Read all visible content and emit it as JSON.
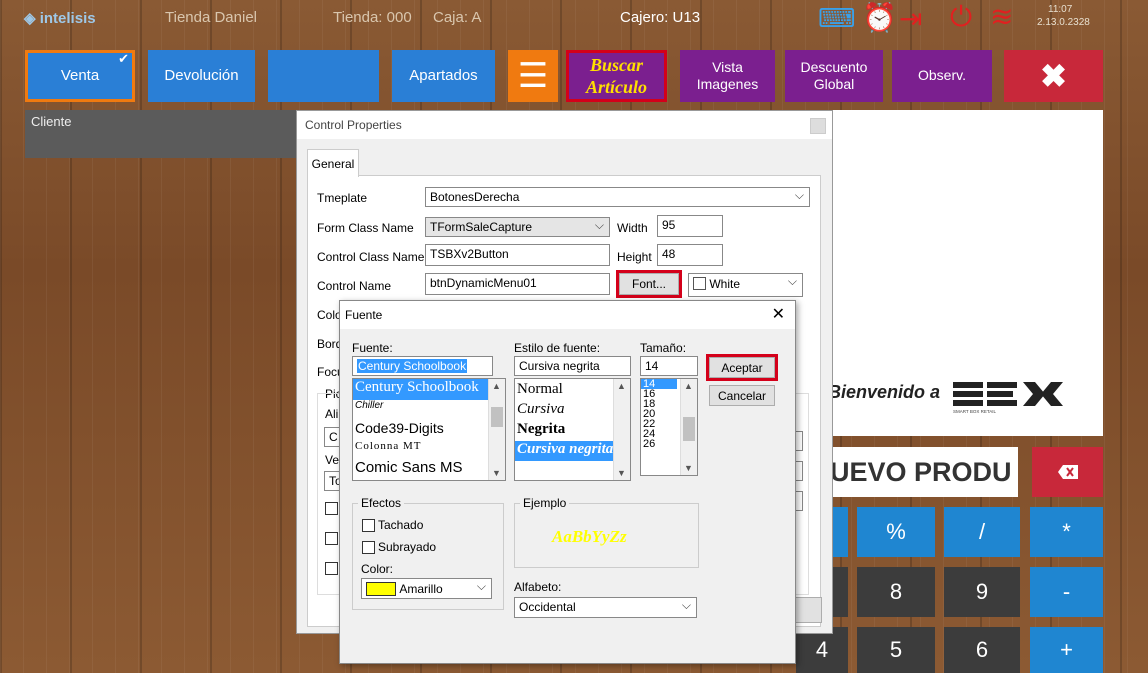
{
  "topbar": {
    "logo": "intelisis",
    "store_user": "Tienda Daniel",
    "store_id": "Tienda: 000",
    "register": "Caja: A",
    "cashier": "Cajero: U13",
    "time": "11:07",
    "version": "2.13.0.2328"
  },
  "actions": {
    "venta": "Venta",
    "devolucion": "Devolución",
    "blank": "",
    "apartados": "Apartados",
    "buscar_line1": "Buscar",
    "buscar_line2": "Artículo",
    "vista_line1": "Vista",
    "vista_line2": "Imagenes",
    "descuento_line1": "Descuento",
    "descuento_line2": "Global",
    "observ": "Observ."
  },
  "cliente_label": "Cliente",
  "welcome_text": "Bienvenido a",
  "sbx_sub": "SMART BOX RETAIL",
  "product_field": "UEVO PRODU",
  "keypad": {
    "percent": "%",
    "divide": "/",
    "multiply": "*",
    "k8": "8",
    "k9": "9",
    "minus": "-",
    "k4": "4",
    "k5": "5",
    "k6": "6",
    "plus": "+"
  },
  "control_properties": {
    "title": "Control Properties",
    "tab_general": "General",
    "template_label": "Tmeplate",
    "template_value": "BotonesDerecha",
    "form_class_label": "Form Class Name",
    "form_class_value": "TFormSaleCapture",
    "width_label": "Width",
    "width_value": "95",
    "control_class_label": "Control Class Name",
    "control_class_value": "TSBXv2Button",
    "height_label": "Height",
    "height_value": "48",
    "control_name_label": "Control Name",
    "control_name_value": "btnDynamicMenu01",
    "font_button": "Font...",
    "color_value": "White",
    "partial_colo": "Colo",
    "partial_bord": "Bord",
    "partial_focu": "Focu",
    "partial_pic": "Pic",
    "partial_ali": "Ali",
    "partial_c": "C",
    "partial_ve": "Ve",
    "partial_to": "To"
  },
  "font_dialog": {
    "title": "Fuente",
    "font_label": "Fuente:",
    "font_value": "Century Schoolbook",
    "fonts": [
      "Century Schoolbook",
      "Chiller",
      "Code39-Digits",
      "Colonna MT",
      "Comic Sans MS"
    ],
    "style_label": "Estilo de fuente:",
    "style_value": "Cursiva negrita",
    "styles": [
      "Normal",
      "Cursiva",
      "Negrita",
      "Cursiva negrita"
    ],
    "size_label": "Tamaño:",
    "size_value": "14",
    "sizes": [
      "14",
      "16",
      "18",
      "20",
      "22",
      "24",
      "26"
    ],
    "accept_button": "Aceptar",
    "cancel_button": "Cancelar",
    "effects_label": "Efectos",
    "strike_label": "Tachado",
    "underline_label": "Subrayado",
    "color_label": "Color:",
    "color_value": "Amarillo",
    "sample_label": "Ejemplo",
    "sample_text": "AaBbYyZz",
    "script_label": "Alfabeto:",
    "script_value": "Occidental"
  },
  "colors": {
    "blue_button": "#2a7fd6",
    "purple_button": "#7b1f8f",
    "red_button": "#c8283a",
    "highlight": "#d4001a",
    "sample_yellow": "#ffff00"
  }
}
